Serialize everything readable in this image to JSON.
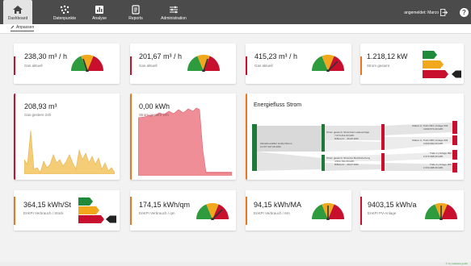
{
  "nav": {
    "items": [
      {
        "label": "Dashboard",
        "icon": "home-icon"
      },
      {
        "label": "Datenpunkte",
        "icon": "datapoints-icon"
      },
      {
        "label": "Analyse",
        "icon": "chart-icon"
      },
      {
        "label": "Reports",
        "icon": "report-icon"
      },
      {
        "label": "Administration",
        "icon": "sliders-icon"
      }
    ],
    "login_text": "angemeldet: Marco",
    "help_label": "?"
  },
  "subbar": {
    "tab": "Anpassen"
  },
  "row1": [
    {
      "value": "238,30 m³ / h",
      "label": "Gas aktuell",
      "accent": "#c8102e",
      "widget": "gauge"
    },
    {
      "value": "201,67 m³ / h",
      "label": "Gas aktuell",
      "accent": "#c8102e",
      "widget": "gauge"
    },
    {
      "value": "415,23 m³ / h",
      "label": "Gas aktuell",
      "accent": "#c8102e",
      "widget": "gauge"
    },
    {
      "value": "1.218,12 kW",
      "label": "Strom gesamt",
      "accent": "#e87722",
      "widget": "energy-label"
    }
  ],
  "row2": {
    "gas24": {
      "value": "208,93 m³",
      "label": "Gas gestern 24h",
      "accent": "#c8102e",
      "area_color": "#f5cd77"
    },
    "strom24": {
      "value": "0,00 kWh",
      "label": "Strom gestern 24h",
      "accent": "#e87722",
      "area_color": "#ef8e96"
    },
    "sankey": {
      "title": "Energiefluss Strom",
      "accent": "#e87722",
      "source_label": "Abnahmezähler GmbH Strom",
      "source_value": "11.577.167,00 kWh",
      "mid1_label": "Strom gesamt | StromGas Ladeverträge",
      "mid1_value": "7.073.213,00 kWh",
      "mid1_diff": "Differenz: - 26,00 kWh",
      "mid2_label": "Strom gesamt | Stromlos Bezirksheizung",
      "mid2_value": "4.504.700,00 kWh",
      "mid2_diff": "Differenz: - 29,07 kWh",
      "right": [
        {
          "label": "Station A, Trafo N04 | Anlage 003",
          "value": "4.000.574,00 kWh"
        },
        {
          "label": "Station A, Trafo N08 | Anlage 002",
          "value": "3.000.000,00 kWh"
        },
        {
          "label": "Trafo 1 | Anlage 002",
          "value": "2.270.398,00 kWh"
        },
        {
          "label": "Trafo 2 | Anlage 006",
          "value": "2.234.498,00 kWh"
        }
      ]
    }
  },
  "row3": [
    {
      "value": "364,15 kWh/St",
      "label": "EnKPI Verbrauch / Stück",
      "accent": "#e87722",
      "widget": "energy-label"
    },
    {
      "value": "174,15 kWh/qm",
      "label": "EnKPI Verbrauch / qm",
      "accent": "#e87722",
      "widget": "gauge"
    },
    {
      "value": "94,15 kWh/MA",
      "label": "EnKPI Verbrauch / MA",
      "accent": "#e87722",
      "widget": "gauge"
    },
    {
      "value": "9403,15 kWh/a",
      "label": "EnKPI PV-Anlage",
      "accent": "#c8102e",
      "widget": "gauge"
    }
  ],
  "colors": {
    "gauge_green": "#2e9b3f",
    "gauge_orange": "#f2a81d",
    "gauge_red": "#c8102e",
    "needle": "#333333",
    "topbar": "#4b4b4b",
    "sankey_green": "#1f7a3a",
    "sankey_red": "#c8102e"
  },
  "footer": {
    "text": "© ivy software gmbh"
  }
}
